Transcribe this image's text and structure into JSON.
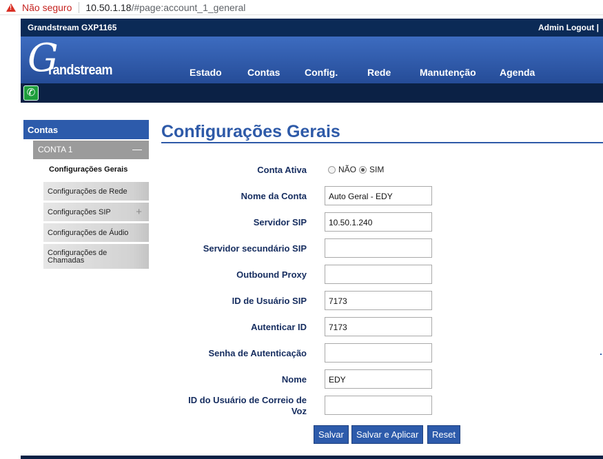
{
  "browser": {
    "security_label": "Não seguro",
    "url_host": "10.50.1.18",
    "url_path": "/#page:account_1_general"
  },
  "header": {
    "model": "Grandstream GXP1165",
    "admin_logout": "Admin Logout |",
    "logo_g": "G",
    "logo_text": "randstream"
  },
  "nav": {
    "items": [
      "Estado",
      "Contas",
      "Config.",
      "Rede",
      "Manutenção",
      "Agenda"
    ]
  },
  "sidebar": {
    "section": "Contas",
    "account": "CONTA 1",
    "account_toggle": "—",
    "current": "Configurações Gerais",
    "items": [
      "Configurações de Rede",
      "Configurações SIP",
      "Configurações de Áudio",
      "Configurações de Chamadas"
    ],
    "sip_expand": "+"
  },
  "main": {
    "title": "Configurações Gerais",
    "active": {
      "label": "Conta Ativa",
      "no": "NÃO",
      "yes": "SIM",
      "selected": "SIM"
    },
    "fields": [
      {
        "label": "Nome da Conta",
        "value": "Auto Geral - EDY"
      },
      {
        "label": "Servidor SIP",
        "value": "10.50.1.240"
      },
      {
        "label": "Servidor secundário SIP",
        "value": ""
      },
      {
        "label": "Outbound Proxy",
        "value": ""
      },
      {
        "label": "ID de Usuário SIP",
        "value": "7173"
      },
      {
        "label": "Autenticar ID",
        "value": "7173"
      },
      {
        "label": "Senha de Autenticação",
        "value": ""
      },
      {
        "label": "Nome",
        "value": "EDY"
      },
      {
        "label": "ID do Usuário de Correio de Voz",
        "value": ""
      }
    ],
    "buttons": {
      "save": "Salvar",
      "save_apply": "Salvar e Aplicar",
      "reset": "Reset"
    }
  },
  "colors": {
    "header_dark": "#0b2a56",
    "banner_blue": "#2f59a8",
    "accent_blue": "#2e5aa8",
    "label_navy": "#172e60",
    "phone_green": "#1e9e3c"
  }
}
